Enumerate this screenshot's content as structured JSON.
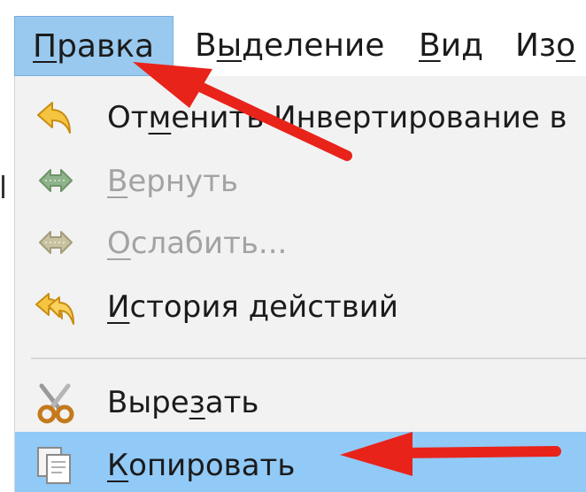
{
  "menubar": {
    "items": [
      {
        "label_mnemonic": "П",
        "label_rest": "равка",
        "active": true
      },
      {
        "label_before": "В",
        "label_mnemonic": "ы",
        "label_rest": "деление",
        "active": false
      },
      {
        "label_mnemonic": "В",
        "label_rest": "ид",
        "active": false
      },
      {
        "label_before": "Из",
        "label_mnemonic": "о",
        "label_rest": "",
        "active": false
      }
    ]
  },
  "edit_menu": {
    "items": [
      {
        "before": "От",
        "mnemonic": "м",
        "rest": "енить Инвертирование в",
        "enabled": true,
        "icon": "undo-icon"
      },
      {
        "before": "",
        "mnemonic": "В",
        "rest": "ернуть",
        "enabled": false,
        "icon": "redo-icon"
      },
      {
        "before": "",
        "mnemonic": "О",
        "rest": "слабить...",
        "enabled": false,
        "icon": "fade-icon"
      },
      {
        "before": "",
        "mnemonic": "И",
        "rest": "стория действий",
        "enabled": true,
        "icon": "history-icon"
      },
      {
        "before": "Выре",
        "mnemonic": "з",
        "rest": "ать",
        "enabled": true,
        "icon": "scissors-icon"
      },
      {
        "before": "",
        "mnemonic": "К",
        "rest": "опировать",
        "enabled": true,
        "highlighted": true,
        "icon": "copy-icon"
      }
    ]
  },
  "colors": {
    "menubar_active": "#99c9ef",
    "item_highlight": "#91c9f7",
    "menu_background": "#f2f2f2",
    "disabled_text": "#a3a3a3",
    "annotation_arrow": "#e8231a"
  },
  "annotations": [
    {
      "type": "arrow",
      "points_to": "menubar-pravka"
    },
    {
      "type": "arrow",
      "points_to": "menu-item-copy"
    }
  ]
}
